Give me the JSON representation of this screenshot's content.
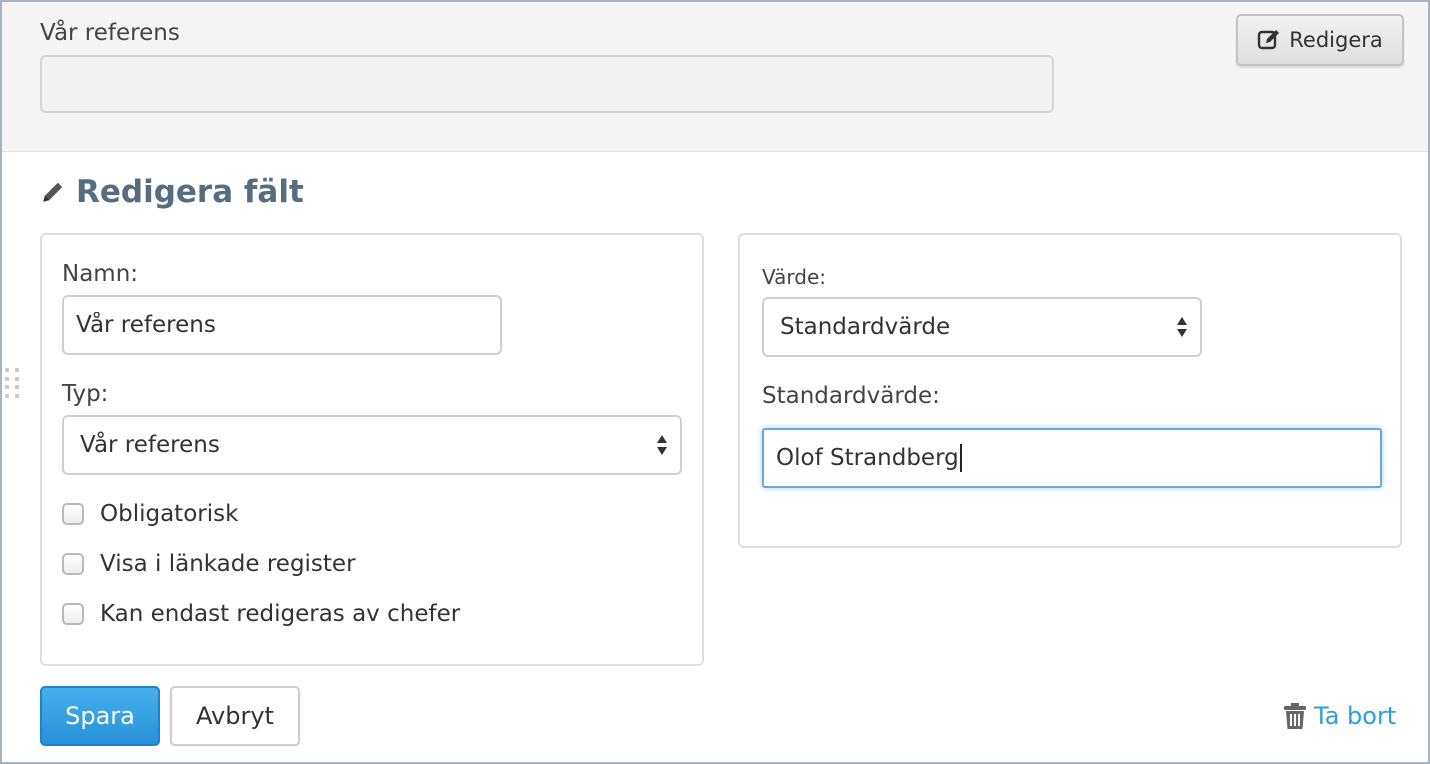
{
  "preview": {
    "label": "Vår referens",
    "value": "",
    "edit_button_label": "Redigera"
  },
  "editor": {
    "heading": "Redigera fält",
    "name_label": "Namn:",
    "name_value": "Vår referens",
    "type_label": "Typ:",
    "type_selected": "Vår referens",
    "checkboxes": [
      {
        "label": "Obligatorisk",
        "checked": false
      },
      {
        "label": "Visa i länkade register",
        "checked": false
      },
      {
        "label": "Kan endast redigeras av chefer",
        "checked": false
      }
    ],
    "value_label": "Värde:",
    "value_selected": "Standardvärde",
    "default_label": "Standardvärde:",
    "default_value": "Olof Strandberg"
  },
  "actions": {
    "save_label": "Spara",
    "cancel_label": "Avbryt",
    "delete_label": "Ta bort"
  },
  "colors": {
    "primary": "#2891d9",
    "heading": "#566c80",
    "link": "#2a9fd8",
    "focus": "#6aa7df"
  },
  "icons": {
    "edit_button": "pencil-square-icon",
    "heading": "pencil-icon",
    "select_arrows": "sort-arrows-icon",
    "delete": "trash-icon",
    "drag": "drag-handle-icon"
  }
}
